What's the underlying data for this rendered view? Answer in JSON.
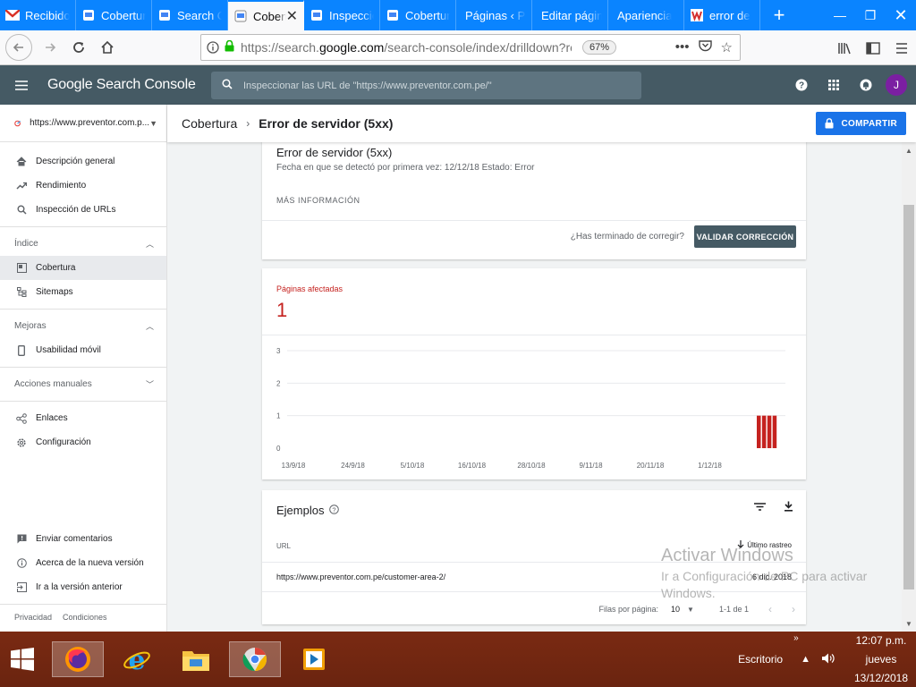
{
  "browser": {
    "tabs": [
      {
        "label": "Recibido",
        "icon": "gmail-icon"
      },
      {
        "label": "Cobertura",
        "icon": "gsc-icon"
      },
      {
        "label": "Search Console",
        "icon": "gsc-icon"
      },
      {
        "label": "Cobertura",
        "icon": "gsc-icon",
        "active": true
      },
      {
        "label": "Inspección",
        "icon": "gsc-icon"
      },
      {
        "label": "Cobertura",
        "icon": "gsc-icon"
      },
      {
        "label": "Páginas ‹ PR",
        "icon": "none"
      },
      {
        "label": "Editar página",
        "icon": "none"
      },
      {
        "label": "Apariencia",
        "icon": "none"
      },
      {
        "label": "error de",
        "icon": "wordfence-icon"
      }
    ],
    "url_prefix": "https://search.",
    "url_domain": "google.com",
    "url_suffix": "/search-console/index/drilldown?re",
    "zoom": "67%"
  },
  "gsc": {
    "brand": "Google Search Console",
    "search_placeholder": "Inspeccionar las URL de \"https://www.preventor.com.pe/\"",
    "avatar_letter": "J",
    "property": "https://www.preventor.com.p...",
    "nav": {
      "overview": "Descripción general",
      "performance": "Rendimiento",
      "url_inspection": "Inspección de URLs",
      "index_section": "Índice",
      "coverage": "Cobertura",
      "sitemaps": "Sitemaps",
      "enhancements_section": "Mejoras",
      "mobile_usability": "Usabilidad móvil",
      "manual_actions": "Acciones manuales",
      "links": "Enlaces",
      "settings": "Configuración",
      "feedback": "Enviar comentarios",
      "about_new": "Acerca de la nueva versión",
      "old_version": "Ir a la versión anterior",
      "privacy": "Privacidad",
      "terms": "Condiciones"
    },
    "breadcrumb": {
      "parent": "Cobertura",
      "current": "Error de servidor (5xx)"
    },
    "share_label": "COMPARTIR",
    "issue": {
      "title": "Error de servidor (5xx)",
      "meta": "Fecha en que se detectó por primera vez: 12/12/18   Estado: Error",
      "more_info": "MÁS INFORMACIÓN",
      "question": "¿Has terminado de corregir?",
      "validate_label": "VALIDAR CORRECCIÓN"
    },
    "affected": {
      "label": "Páginas afectadas",
      "count": "1"
    },
    "examples": {
      "title": "Ejemplos",
      "col_url": "URL",
      "col_last_crawl": "Último rastreo",
      "rows": [
        {
          "url": "https://www.preventor.com.pe/customer-area-2/",
          "date": "6 dic. 2018"
        }
      ],
      "rows_per_page_label": "Filas por página:",
      "rows_per_page": "10",
      "range": "1-1 de 1"
    }
  },
  "chart_data": {
    "type": "bar",
    "title": "",
    "xlabel": "",
    "ylabel": "",
    "ylim": [
      0,
      3
    ],
    "yticks": [
      0,
      1,
      2,
      3
    ],
    "xtick_labels": [
      "13/9/18",
      "24/9/18",
      "5/10/18",
      "16/10/18",
      "28/10/18",
      "9/11/18",
      "20/11/18",
      "1/12/18"
    ],
    "series": [
      {
        "values": [
          1,
          1,
          1,
          1
        ]
      }
    ],
    "bar_positions_note": "four bars after 1/12/18",
    "color": "#c5221f",
    "grid": true
  },
  "watermark": {
    "line1": "Activar Windows",
    "line2": "Ir a Configuración de PC para activar Windows."
  },
  "taskbar": {
    "desktop_label": "Escritorio",
    "time": "12:07 p.m.",
    "day": "jueves",
    "date": "13/12/2018"
  },
  "colors": {
    "browser_accent": "#0a84ff",
    "gsc_header": "#455a64",
    "error_red": "#c5221f",
    "share_blue": "#1a73e8",
    "taskbar": "#6e2510"
  }
}
